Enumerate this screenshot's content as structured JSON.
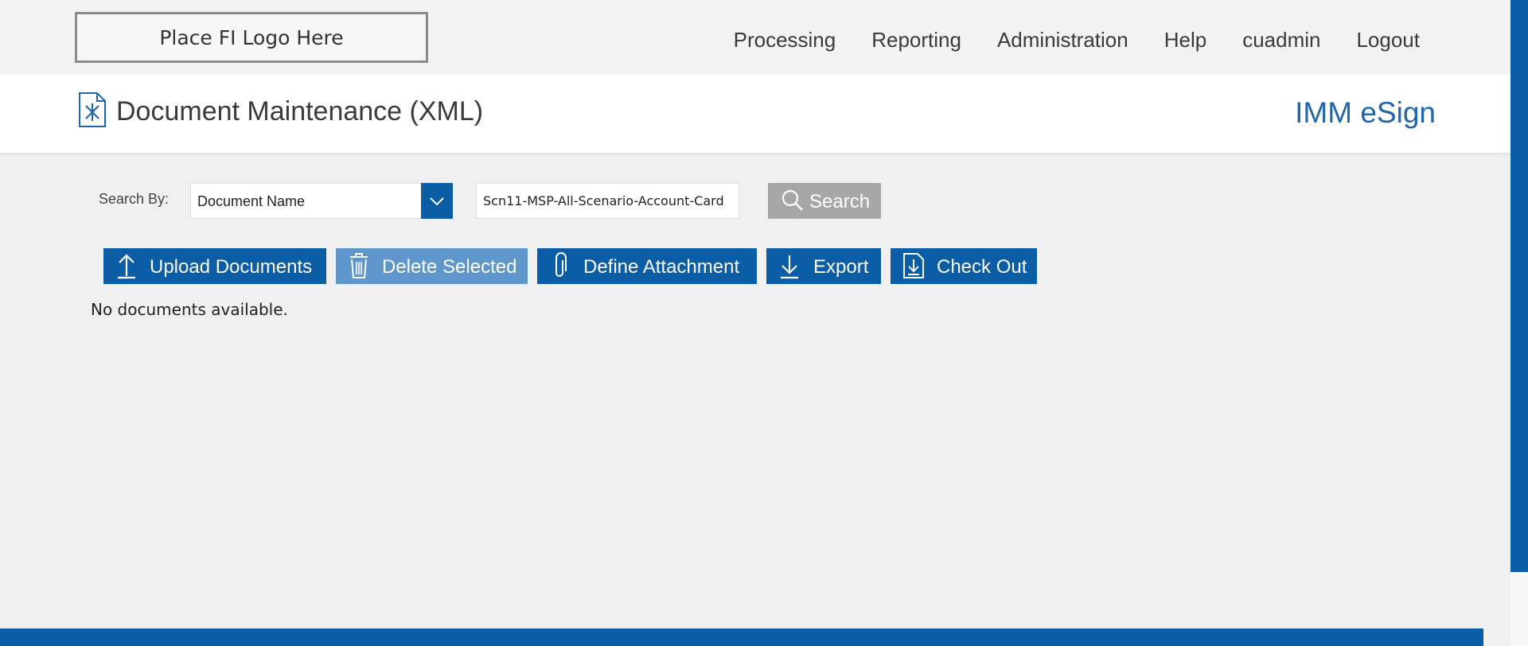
{
  "header": {
    "logo_text": "Place FI Logo Here",
    "nav": [
      {
        "label": "Processing"
      },
      {
        "label": "Reporting"
      },
      {
        "label": "Administration"
      },
      {
        "label": "Help"
      },
      {
        "label": "cuadmin"
      },
      {
        "label": "Logout"
      }
    ]
  },
  "page": {
    "title": "Document Maintenance (XML)",
    "brand": "IMM eSign"
  },
  "search": {
    "label": "Search By:",
    "by_selected": "Document Name",
    "query_value": "Scn11-MSP-All-Scenario-Account-Card",
    "button_label": "Search"
  },
  "actions": {
    "upload_label": "Upload Documents",
    "delete_label": "Delete Selected",
    "attachment_label": "Define Attachment",
    "export_label": "Export",
    "checkout_label": "Check Out"
  },
  "results": {
    "empty_message": "No documents available."
  },
  "colors": {
    "primary": "#0b5da6",
    "disabled": "#5f97cd",
    "search_button": "#a7a7a7",
    "brand_text": "#1f66ad"
  }
}
